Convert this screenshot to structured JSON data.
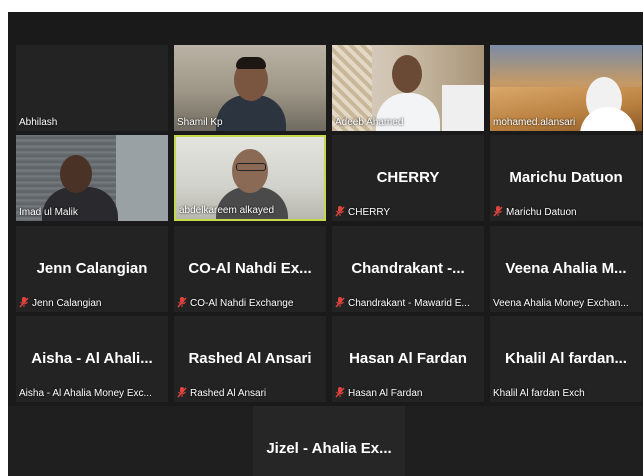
{
  "tiles": [
    {
      "label": "Abhilash",
      "big": "",
      "muted": false
    },
    {
      "label": "Shamil Kp",
      "big": "",
      "muted": false
    },
    {
      "label": "Adeeb Ahamed",
      "big": "",
      "muted": false
    },
    {
      "label": "mohamed.alansari",
      "big": "",
      "muted": false
    },
    {
      "label": "Imad ul Malik",
      "big": "",
      "muted": false
    },
    {
      "label": "abdelkareem alkayed",
      "big": "",
      "muted": false
    },
    {
      "label": "CHERRY",
      "big": "CHERRY",
      "muted": true
    },
    {
      "label": "Marichu Datuon",
      "big": "Marichu Datuon",
      "muted": true
    },
    {
      "label": "Jenn Calangian",
      "big": "Jenn Calangian",
      "muted": true
    },
    {
      "label": "CO-Al Nahdi Exchange",
      "big": "CO-Al Nahdi Ex...",
      "muted": true
    },
    {
      "label": "Chandrakant - Mawarid E...",
      "big": "Chandrakant -...",
      "muted": true
    },
    {
      "label": "Veena Ahalia Money Exchan...",
      "big": "Veena Ahalia M...",
      "muted": false
    },
    {
      "label": "Aisha - Al Ahalia Money Exc...",
      "big": "Aisha - Al Ahali...",
      "muted": false
    },
    {
      "label": "Rashed Al Ansari",
      "big": "Rashed Al Ansari",
      "muted": true
    },
    {
      "label": "Hasan Al Fardan",
      "big": "Hasan Al Fardan",
      "muted": true
    },
    {
      "label": "Khalil Al fardan Exch",
      "big": "Khalil Al fardan...",
      "muted": false
    },
    {
      "label": "",
      "big": "Jizel - Ahalia Ex...",
      "muted": false
    }
  ],
  "colors": {
    "active_border": "#c5d94a",
    "mute_icon": "#e0443e"
  }
}
